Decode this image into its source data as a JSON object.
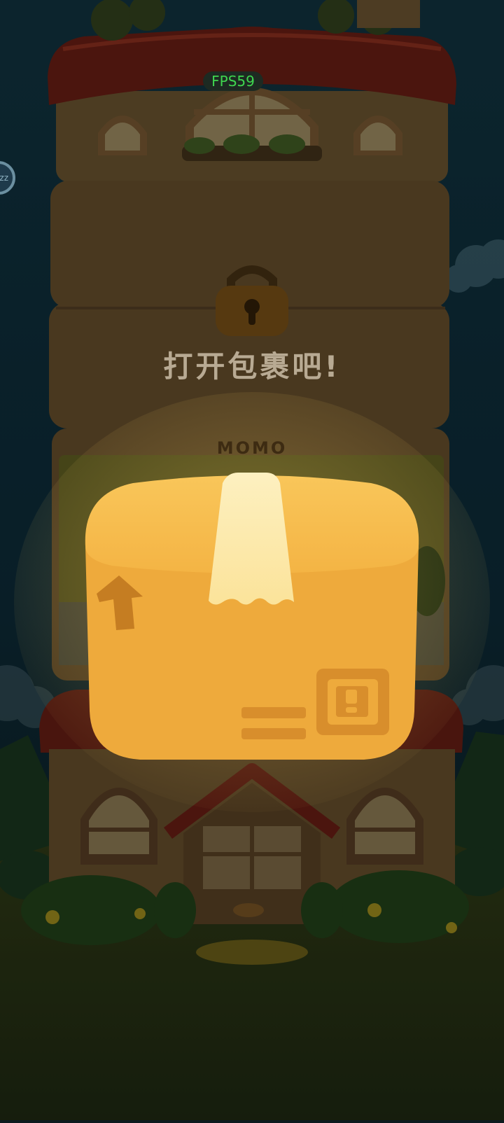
{
  "hud": {
    "fps_text": "FPS59",
    "side_button_text": "zz"
  },
  "prompt": {
    "text": "打开包裹吧!"
  },
  "building": {
    "sign_text": "MOMO"
  },
  "package": {
    "state": "closed"
  },
  "colors": {
    "overlay": "#000000",
    "box_top": "#f7bc4a",
    "box_body": "#eeaa3c",
    "tape": "#fde7a0",
    "roof": "#6b1a14"
  }
}
